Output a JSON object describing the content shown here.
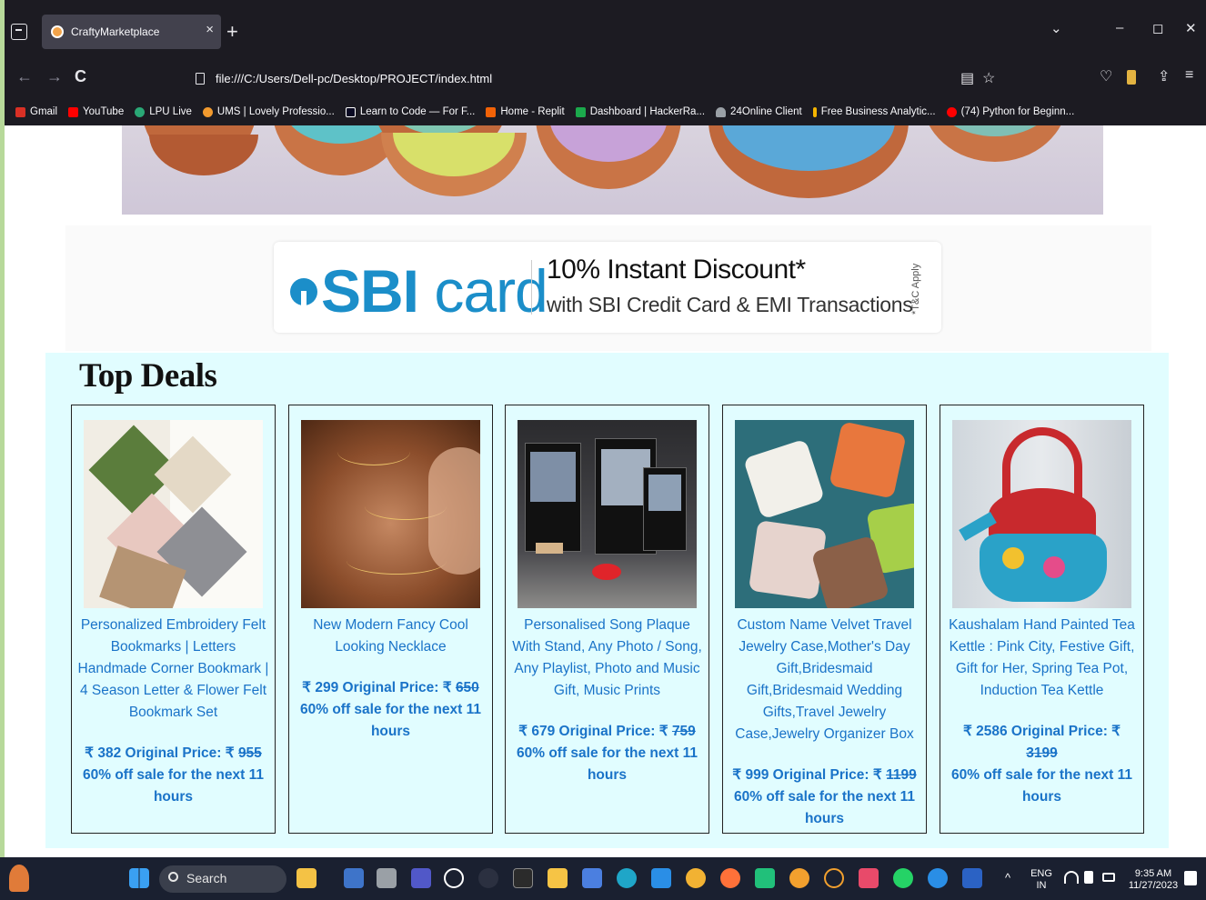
{
  "browser": {
    "tab_title": "CraftyMarketplace",
    "tab_close": "×",
    "new_tab": "+",
    "tab_list_chevron": "⌄",
    "minimize": "–",
    "restore": "◻",
    "close": "✕",
    "url": "file:///C:/Users/Dell-pc/Desktop/PROJECT/index.html",
    "back": "←",
    "forward": "→",
    "reload": "C",
    "reader": "▤",
    "star": "☆",
    "pocket": "♡",
    "share": "⇪",
    "menu": "≡",
    "bookmarks": [
      {
        "label": "Gmail",
        "color": "#d93025"
      },
      {
        "label": "YouTube",
        "color": "#ff0000"
      },
      {
        "label": "LPU Live",
        "color": "#2aa876"
      },
      {
        "label": "UMS | Lovely Professio...",
        "color": "#f29a2e"
      },
      {
        "label": "Learn to Code — For F...",
        "color": "#0a0a23"
      },
      {
        "label": "Home - Replit",
        "color": "#f26207"
      },
      {
        "label": "Dashboard | HackerRa...",
        "color": "#1ba94c"
      },
      {
        "label": "24Online Client",
        "color": "#9aa0a6"
      },
      {
        "label": "Free Business Analytic...",
        "color": "#f4b400"
      },
      {
        "label": "(74) Python for Beginn...",
        "color": "#ff0000"
      }
    ]
  },
  "banner": {
    "logo_sbi": "SBI",
    "logo_card": " card",
    "title": "10% Instant Discount*",
    "subtitle": "with SBI Credit Card & EMI Transactions",
    "tnc": "*T&C Apply"
  },
  "deals": {
    "title": "Top Deals",
    "products": [
      {
        "name": "Personalized Embroidery Felt Bookmarks | Letters Handmade Corner Bookmark | 4 Season Letter & Flower Felt Bookmark Set",
        "price": "₹ 382 Original Price: ₹",
        "original": "955",
        "sale": "60% off sale for the next 11 hours"
      },
      {
        "name": "New Modern Fancy Cool Looking Necklace",
        "price": "₹ 299 Original Price: ₹",
        "original": "650",
        "sale": "60% off sale for the next 11 hours"
      },
      {
        "name": "Personalised Song Plaque With Stand, Any Photo / Song, Any Playlist, Photo and Music Gift, Music Prints",
        "price": "₹ 679 Original Price: ₹",
        "original": "759",
        "sale": "60% off sale for the next 11 hours"
      },
      {
        "name": "Custom Name Velvet Travel Jewelry Case,Mother's Day Gift,Bridesmaid Gift,Bridesmaid Wedding Gifts,Travel Jewelry Case,Jewelry Organizer Box",
        "price": "₹ 999 Original Price: ₹",
        "original": "1199",
        "sale": "60% off sale for the next 11 hours"
      },
      {
        "name": "Kaushalam Hand Painted Tea Kettle : Pink City, Festive Gift, Gift for Her, Spring Tea Pot, Induction Tea Kettle",
        "price": "₹ 2586 Original Price: ₹",
        "original": "3199",
        "sale": "60% off sale for the next 11 hours"
      }
    ]
  },
  "taskbar": {
    "search": "Search",
    "lang1": "ENG",
    "lang2": "IN",
    "time": "9:35 AM",
    "date": "11/27/2023",
    "tray_chevron": "^"
  }
}
